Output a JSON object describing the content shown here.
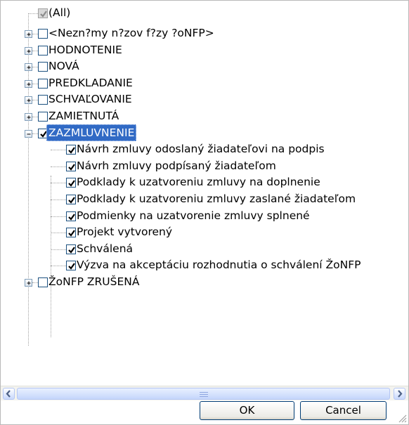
{
  "tree": {
    "all_label": "(All)",
    "items": [
      {
        "label": "<Nezn?my n?zov f?zy ?oNFP>",
        "expanded": false,
        "checked": false
      },
      {
        "label": "HODNOTENIE",
        "expanded": false,
        "checked": false
      },
      {
        "label": "NOVÁ",
        "expanded": false,
        "checked": false
      },
      {
        "label": "PREDKLADANIE",
        "expanded": false,
        "checked": false
      },
      {
        "label": "SCHVAĽOVANIE",
        "expanded": false,
        "checked": false
      },
      {
        "label": "ZAMIETNUTÁ",
        "expanded": false,
        "checked": false
      },
      {
        "label": "ZAZMLUVNENIE",
        "expanded": true,
        "checked": true,
        "selected": true,
        "children": [
          {
            "label": "Návrh zmluvy odoslaný žiadateľovi na podpis",
            "checked": true
          },
          {
            "label": "Návrh zmluvy podpísaný žiadateľom",
            "checked": true
          },
          {
            "label": "Podklady k uzatvoreniu zmluvy na doplnenie",
            "checked": true
          },
          {
            "label": "Podklady k uzatvoreniu zmluvy zaslané žiadateľom",
            "checked": true
          },
          {
            "label": "Podmienky na uzatvorenie zmluvy splnené",
            "checked": true
          },
          {
            "label": "Projekt vytvorený",
            "checked": true
          },
          {
            "label": "Schválená",
            "checked": true
          },
          {
            "label": "Výzva na akceptáciu rozhodnutia o schválení ŽoNFP",
            "checked": true
          }
        ]
      },
      {
        "label": "ŽoNFP ZRUŠENÁ",
        "expanded": false,
        "checked": false
      }
    ]
  },
  "buttons": {
    "ok": "OK",
    "cancel": "Cancel"
  },
  "colors": {
    "selection": "#316ac5",
    "checkbox_border": "#1c5180",
    "check_mark": "#21a121"
  }
}
